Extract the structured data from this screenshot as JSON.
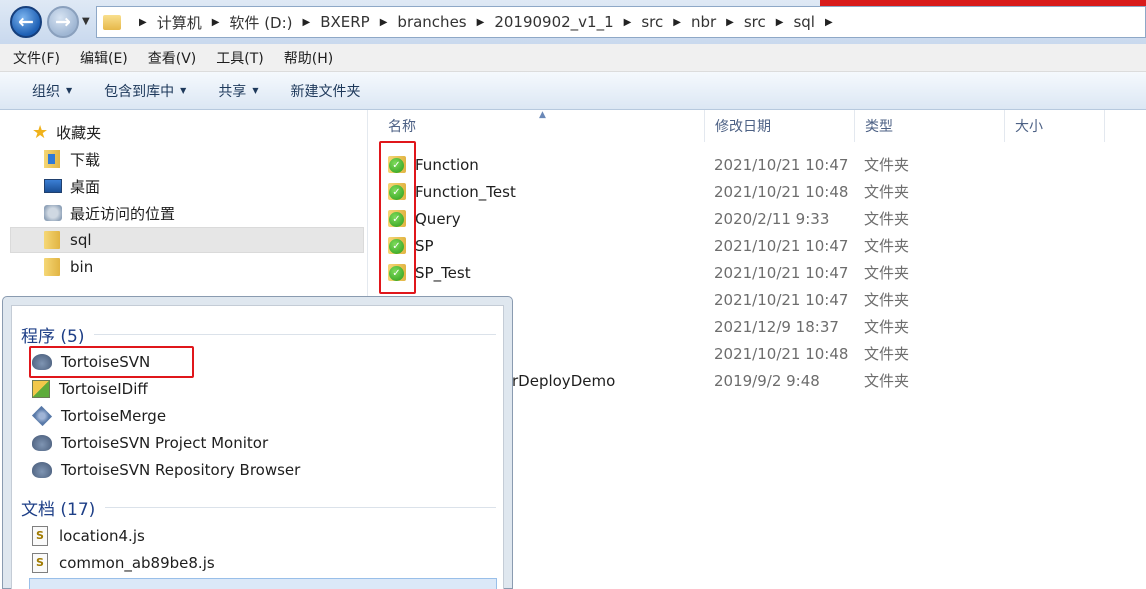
{
  "address": {
    "crumbs": [
      "计算机",
      "软件 (D:)",
      "BXERP",
      "branches",
      "20190902_v1_1",
      "src",
      "nbr",
      "src",
      "sql"
    ]
  },
  "menubar": [
    "文件(F)",
    "编辑(E)",
    "查看(V)",
    "工具(T)",
    "帮助(H)"
  ],
  "toolbar": [
    "组织",
    "包含到库中",
    "共享",
    "新建文件夹"
  ],
  "nav": {
    "favorites": "收藏夹",
    "downloads": "下载",
    "desktop": "桌面",
    "recent": "最近访问的位置",
    "sql": "sql",
    "bin": "bin"
  },
  "columns": {
    "name": "名称",
    "modified": "修改日期",
    "type": "类型",
    "size": "大小"
  },
  "rows": [
    {
      "name": "Function",
      "date": "2021/10/21 10:47",
      "type": "文件夹"
    },
    {
      "name": "Function_Test",
      "date": "2021/10/21 10:48",
      "type": "文件夹"
    },
    {
      "name": "Query",
      "date": "2020/2/11 9:33",
      "type": "文件夹"
    },
    {
      "name": "SP",
      "date": "2021/10/21 10:47",
      "type": "文件夹"
    },
    {
      "name": "SP_Test",
      "date": "2021/10/21 10:47",
      "type": "文件夹"
    },
    {
      "name": "",
      "date": "2021/10/21 10:47",
      "type": "文件夹"
    },
    {
      "name": "",
      "date": "2021/12/9 18:37",
      "type": "文件夹"
    },
    {
      "name": "",
      "date": "2021/10/21 10:48",
      "type": "文件夹"
    },
    {
      "name": "rDeployDemo",
      "date": "2019/9/2 9:48",
      "type": "文件夹"
    }
  ],
  "popup": {
    "programs_header": "程序 (5)",
    "programs": [
      "TortoiseSVN",
      "TortoiseIDiff",
      "TortoiseMerge",
      "TortoiseSVN Project Monitor",
      "TortoiseSVN Repository Browser"
    ],
    "documents_header": "文档 (17)",
    "documents": [
      "location4.js",
      "common_ab89be8.js"
    ]
  },
  "icons": {
    "back": "back-arrow-icon",
    "forward": "forward-arrow-icon",
    "folder": "folder-icon",
    "svn_folder": "svn-folder-ok-icon",
    "tortoise": "tortoise-icon",
    "js": "js-file-icon"
  },
  "colors": {
    "highlight": "#e0161b",
    "accent": "#1e3f87"
  }
}
